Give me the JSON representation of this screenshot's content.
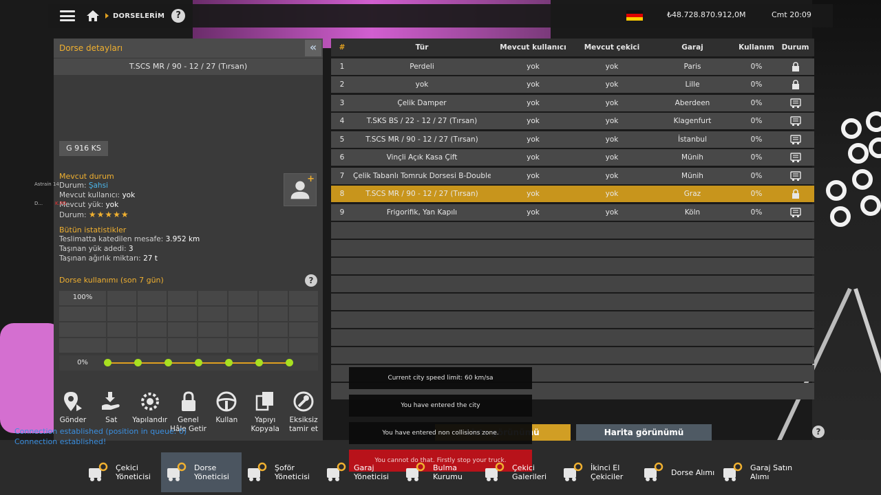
{
  "topbar": {
    "breadcrumb": "DORSELERİM",
    "help": "?",
    "money": "₺48.728.870.912,0M",
    "time": "Cmt 20:09"
  },
  "left": {
    "title": "Dorse detayları",
    "trailer_name": "T.SCS MR / 90 - 12 / 27 (Tırsan)",
    "plate": "G 916 KS",
    "status_title": "Mevcut durum",
    "status": [
      {
        "label": "Durum:",
        "value": "Şahsi"
      },
      {
        "label": "Mevcut kullanıcı:",
        "value": "yok"
      },
      {
        "label": "Mevcut yük:",
        "value": "yok"
      },
      {
        "label": "Durum:",
        "value": "★★★★★"
      }
    ],
    "stats_title": "Bütün istatistikler",
    "stats": [
      {
        "label": "Teslimatta katedilen mesafe:",
        "value": "3.952 km"
      },
      {
        "label": "Taşınan yük adedi:",
        "value": "3"
      },
      {
        "label": "Taşınan ağırlık miktarı:",
        "value": "27 t"
      }
    ],
    "usage_title": "Dorse kullanımı (son 7 gün)",
    "usage_top": "100%",
    "usage_bottom": "0%",
    "usage_values": [
      0,
      0,
      0,
      0,
      0,
      0,
      0
    ],
    "actions": [
      {
        "label": "Gönder",
        "icon": "map-pin-icon"
      },
      {
        "label": "Sat",
        "icon": "sell-hand-icon"
      },
      {
        "label": "Yapılandır",
        "icon": "gear-icon"
      },
      {
        "label": "Genel\nHâle Getir",
        "icon": "lock-icon"
      },
      {
        "label": "Kullan",
        "icon": "steering-wheel-icon"
      },
      {
        "label": "Yapıyı\nKopyala",
        "icon": "copy-icon"
      },
      {
        "label": "Eksiksiz\ntamir et",
        "icon": "wrench-icon"
      }
    ]
  },
  "table": {
    "headers": [
      "#",
      "Tür",
      "Mevcut kullanıcı",
      "Mevcut çekici",
      "Garaj",
      "Kullanım",
      "Durum"
    ],
    "rows": [
      {
        "n": "1",
        "type": "Perdeli",
        "user": "yok",
        "truck": "yok",
        "garage": "Paris",
        "usage": "0%",
        "status": "lock"
      },
      {
        "n": "2",
        "type": "yok",
        "user": "yok",
        "truck": "yok",
        "garage": "Lille",
        "usage": "0%",
        "status": "lock"
      },
      {
        "n": "3",
        "type": "Çelik Damper",
        "user": "yok",
        "truck": "yok",
        "garage": "Aberdeen",
        "usage": "0%",
        "status": "trailer"
      },
      {
        "n": "4",
        "type": "T.SKS BS / 22 - 12 / 27 (Tırsan)",
        "user": "yok",
        "truck": "yok",
        "garage": "Klagenfurt",
        "usage": "0%",
        "status": "trailer"
      },
      {
        "n": "5",
        "type": "T.SCS MR / 90 - 12 / 27 (Tırsan)",
        "user": "yok",
        "truck": "yok",
        "garage": "İstanbul",
        "usage": "0%",
        "status": "trailer"
      },
      {
        "n": "6",
        "type": "Vinçli Açık Kasa Çift",
        "user": "yok",
        "truck": "yok",
        "garage": "Münih",
        "usage": "0%",
        "status": "trailer"
      },
      {
        "n": "7",
        "type": "Çelik Tabanlı Tomruk Dorsesi B-Double",
        "user": "yok",
        "truck": "yok",
        "garage": "Münih",
        "usage": "0%",
        "status": "trailer"
      },
      {
        "n": "8",
        "type": "T.SCS MR / 90 - 12 / 27 (Tırsan)",
        "user": "yok",
        "truck": "yok",
        "garage": "Graz",
        "usage": "0%",
        "status": "lock",
        "selected": true
      },
      {
        "n": "9",
        "type": "Frigorifik, Yan Kapılı",
        "user": "yok",
        "truck": "yok",
        "garage": "Köln",
        "usage": "0%",
        "status": "trailer"
      }
    ],
    "empty_rows": 10
  },
  "buttons": {
    "left": "Liste görünümü",
    "map": "Harita görünümü"
  },
  "notifications": [
    "Current city speed limit: 60 km/sa",
    "You have entered the city",
    "You have entered non collisions zone.",
    "You cannot do that. Firstly stop your truck."
  ],
  "chat": [
    "Connection established (position in queue: 0)",
    "Connection established!"
  ],
  "players": [
    "Astrain 14",
    "D...",
    "K.PO"
  ],
  "nav": [
    {
      "label": "Çekici\nYöneticisi",
      "icon": "truck-gear-icon"
    },
    {
      "label": "Dorse\nYöneticisi",
      "icon": "trailer-gear-icon",
      "active": true
    },
    {
      "label": "Şoför\nYöneticisi",
      "icon": "driver-gear-icon"
    },
    {
      "label": "Garaj\nYöneticisi",
      "icon": "garage-gear-icon"
    },
    {
      "label": "Bulma\nKurumu",
      "icon": "search-icon"
    },
    {
      "label": "Çekici\nGalerileri",
      "icon": "truck-dealer-icon"
    },
    {
      "label": "İkinci El\nÇekiciler",
      "icon": "used-truck-icon"
    },
    {
      "label": "Dorse Alımı",
      "icon": "trailer-buy-icon"
    },
    {
      "label": "Garaj Satın\nAlımı",
      "icon": "garage-buy-icon"
    }
  ]
}
